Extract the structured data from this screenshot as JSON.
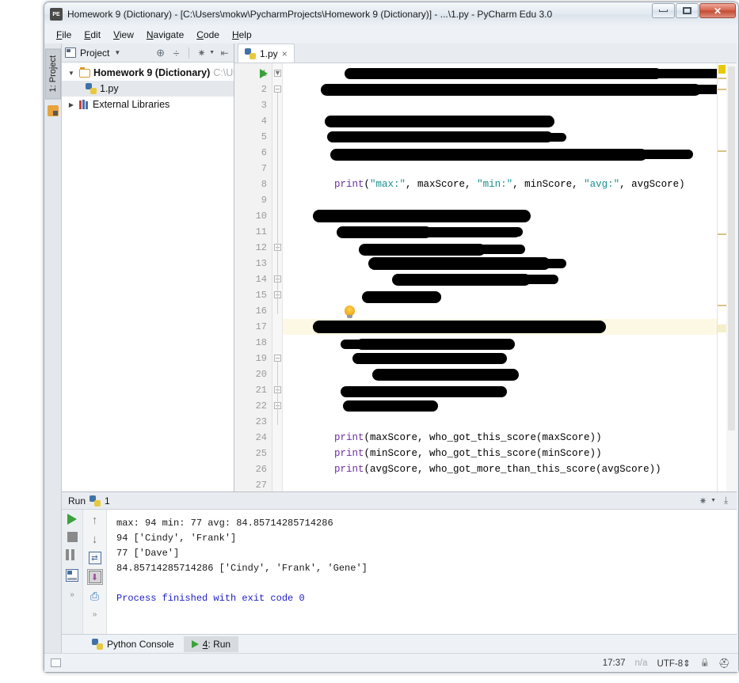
{
  "window": {
    "title": "Homework 9 (Dictionary) - [C:\\Users\\mokw\\PycharmProjects\\Homework 9 (Dictionary)] - ...\\1.py - PyCharm Edu 3.0",
    "app_icon": "pycharm-edu-icon",
    "minimize": "–",
    "maximize": "□",
    "close": "✕"
  },
  "menu": {
    "items": [
      {
        "label": "File",
        "mnemonic": "F"
      },
      {
        "label": "Edit",
        "mnemonic": "E"
      },
      {
        "label": "View",
        "mnemonic": "V"
      },
      {
        "label": "Navigate",
        "mnemonic": "N"
      },
      {
        "label": "Code",
        "mnemonic": "C"
      },
      {
        "label": "Help",
        "mnemonic": "H"
      }
    ]
  },
  "left_tool_window_bar": {
    "project_tab": "1: Project"
  },
  "project_panel": {
    "header_label": "Project",
    "toolbar": [
      "locate-icon",
      "collapse-all-icon",
      "settings-gear-icon",
      "hide-panel-icon"
    ],
    "tree": [
      {
        "label": "Homework 9 (Dictionary)",
        "path_hint": "C:\\Us",
        "icon": "folder-icon",
        "expanded": true,
        "selected": false
      },
      {
        "label": "1.py",
        "icon": "python-file-icon",
        "expanded": false,
        "selected": true
      },
      {
        "label": "External Libraries",
        "icon": "libraries-icon",
        "expanded": false,
        "selected": false
      }
    ]
  },
  "editor": {
    "tab": {
      "label": "1.py",
      "icon": "python-file-icon",
      "close": "×"
    },
    "current_line": 17,
    "first_visible_line": 1,
    "last_visible_line": 27,
    "lines": [
      {
        "n": 1,
        "redacted": true,
        "text": ""
      },
      {
        "n": 2,
        "redacted": true,
        "text": ""
      },
      {
        "n": 3,
        "redacted": false,
        "text": ""
      },
      {
        "n": 4,
        "redacted": true,
        "text": ""
      },
      {
        "n": 5,
        "redacted": true,
        "text": ""
      },
      {
        "n": 6,
        "redacted": true,
        "text": ""
      },
      {
        "n": 7,
        "redacted": false,
        "text": ""
      },
      {
        "n": 8,
        "redacted": false,
        "text": "print(\"max:\", maxScore, \"min:\", minScore, \"avg:\", avgScore)"
      },
      {
        "n": 9,
        "redacted": false,
        "text": ""
      },
      {
        "n": 10,
        "redacted": true,
        "text": ""
      },
      {
        "n": 11,
        "redacted": true,
        "text": ""
      },
      {
        "n": 12,
        "redacted": true,
        "text": ""
      },
      {
        "n": 13,
        "redacted": true,
        "text": ""
      },
      {
        "n": 14,
        "redacted": true,
        "text": ""
      },
      {
        "n": 15,
        "redacted": true,
        "text": ""
      },
      {
        "n": 16,
        "redacted": false,
        "text": ""
      },
      {
        "n": 17,
        "redacted": true,
        "text": ""
      },
      {
        "n": 18,
        "redacted": true,
        "text": ""
      },
      {
        "n": 19,
        "redacted": true,
        "text": ""
      },
      {
        "n": 20,
        "redacted": true,
        "text": ""
      },
      {
        "n": 21,
        "redacted": true,
        "text": ""
      },
      {
        "n": 22,
        "redacted": true,
        "text": ""
      },
      {
        "n": 23,
        "redacted": false,
        "text": ""
      },
      {
        "n": 24,
        "redacted": false,
        "text": "print(maxScore, who_got_this_score(maxScore))"
      },
      {
        "n": 25,
        "redacted": false,
        "text": "print(minScore, who_got_this_score(minScore))"
      },
      {
        "n": 26,
        "redacted": false,
        "text": "print(avgScore, who_got_more_than_this_score(avgScore))"
      },
      {
        "n": 27,
        "redacted": false,
        "text": ""
      }
    ],
    "code_tokens": {
      "line8": [
        {
          "t": "print",
          "c": "fn"
        },
        {
          "t": "(",
          "c": ""
        },
        {
          "t": "\"max:\"",
          "c": "str"
        },
        {
          "t": ", maxScore, ",
          "c": ""
        },
        {
          "t": "\"min:\"",
          "c": "str"
        },
        {
          "t": ", minScore, ",
          "c": ""
        },
        {
          "t": "\"avg:\"",
          "c": "str"
        },
        {
          "t": ", avgScore)",
          "c": ""
        }
      ],
      "line24": [
        {
          "t": "print",
          "c": "fn"
        },
        {
          "t": "(maxScore, who_got_this_score(maxScore))",
          "c": ""
        }
      ],
      "line25": [
        {
          "t": "print",
          "c": "fn"
        },
        {
          "t": "(minScore, who_got_this_score(minScore))",
          "c": ""
        }
      ],
      "line26": [
        {
          "t": "print",
          "c": "fn"
        },
        {
          "t": "(avgScore, who_got_more_than_this_score(avgScore))",
          "c": ""
        }
      ]
    },
    "gutter_icons": {
      "run_marker_line": 1,
      "intention_bulb_line": 16
    }
  },
  "run_panel": {
    "title": "Run",
    "tab_number": "1",
    "icon": "python-icon",
    "toolbar_right": [
      "settings-gear-icon",
      "hide-panel-icon"
    ],
    "buttons_left": [
      "rerun-icon",
      "stop-icon",
      "pause-icon",
      "show-console-icon"
    ],
    "buttons_right": [
      "scroll-up-icon",
      "scroll-down-icon",
      "soft-wrap-icon",
      "scroll-to-end-icon",
      "print-icon"
    ],
    "output": [
      "max: 94 min: 77 avg: 84.85714285714286",
      "94 ['Cindy', 'Frank']",
      "77 ['Dave']",
      "84.85714285714286 ['Cindy', 'Frank', 'Gene']",
      "",
      "Process finished with exit code 0"
    ],
    "finish_message": "Process finished with exit code 0"
  },
  "bottom_tabs": [
    {
      "label": "Python Console",
      "icon": "python-icon",
      "active": false
    },
    {
      "label": "4: Run",
      "mnemonic": "4",
      "icon": "run-play-icon",
      "active": true
    }
  ],
  "status_bar": {
    "time": "17:37",
    "memory": "n/a",
    "encoding": "UTF-8",
    "lock_icon": "lock-icon",
    "hat_icon": "hector-hat-icon"
  },
  "colors": {
    "accent_green": "#3aa23a",
    "string_teal": "#1a8f8f",
    "keyword_purple": "#6a2fa0",
    "console_blue": "#2020c8",
    "current_line": "#fdf8e3",
    "marker_yellow": "#e8c90c"
  }
}
